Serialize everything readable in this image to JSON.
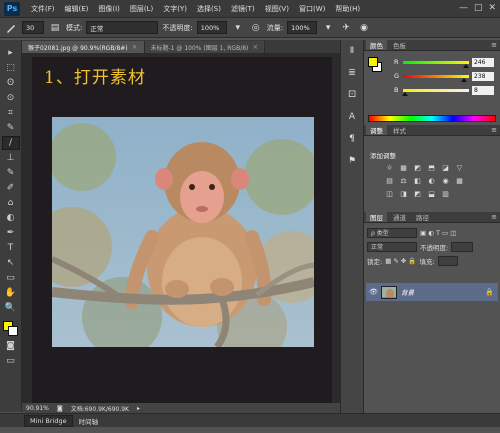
{
  "app": {
    "logo": "Ps"
  },
  "menu": [
    "文件(F)",
    "编辑(E)",
    "图像(I)",
    "图层(L)",
    "文字(Y)",
    "选择(S)",
    "滤镜(T)",
    "视图(V)",
    "窗口(W)",
    "帮助(H)"
  ],
  "window_controls": [
    "—",
    "□",
    "✕"
  ],
  "options": {
    "brush_size": "30",
    "mode_label": "模式:",
    "mode_value": "正常",
    "opacity_label": "不透明度:",
    "opacity_value": "100%",
    "flow_label": "流量:",
    "flow_value": "100%"
  },
  "doc_tabs": [
    {
      "label": "猴子02081.jpg @ 90.9%(RGB/8#)",
      "close": "×"
    },
    {
      "label": "未标题-1 @ 100% (图层 1, RGB/8)",
      "close": "×"
    }
  ],
  "canvas": {
    "step_title": "1、打开素材"
  },
  "status": {
    "zoom": "90.91%",
    "doc_info": "文档:690.9K/690.9K"
  },
  "bottom_tabs": [
    "Mini Bridge",
    "时间轴"
  ],
  "color_panel": {
    "tabs": [
      "颜色",
      "色板"
    ],
    "channels": [
      {
        "name": "R",
        "value": "246",
        "gradient": "linear-gradient(to right, #00f208, #fff208)",
        "knob": 0.96
      },
      {
        "name": "G",
        "value": "238",
        "gradient": "linear-gradient(to right, #f60008, #f6ff08)",
        "knob": 0.93
      },
      {
        "name": "B",
        "value": "8",
        "gradient": "linear-gradient(to right, #f6ee00, #f6eeff)",
        "knob": 0.03
      }
    ]
  },
  "adjust_panel": {
    "tabs": [
      "调整",
      "样式"
    ],
    "title": "添加调整",
    "icons": [
      "☼",
      "▦",
      "◩",
      "⬒",
      "◪",
      "▽",
      "",
      "▤",
      "⚖",
      "◧",
      "◐",
      "◉",
      "▦",
      "",
      "◫",
      "◨",
      "◩",
      "⬓",
      "▥",
      "",
      ""
    ]
  },
  "layers_panel": {
    "tabs": [
      "图层",
      "通道",
      "路径"
    ],
    "filter_label": "ρ 类型",
    "blend_mode": "正常",
    "opacity_label": "不透明度:",
    "lock_label": "锁定:",
    "fill_label": "填充:",
    "layer_name": "背景",
    "bottom_icons": [
      "ɕɔ",
      "fx",
      "◘",
      "◑",
      "▭",
      "▣",
      "🗑"
    ]
  },
  "tools": [
    "▸",
    "⬚",
    "ʘ",
    "⊙",
    "⌗",
    "✎",
    "∕",
    "⊥",
    "✎",
    "✐",
    "⌂",
    "◐",
    "✒",
    "T",
    "↖",
    "▭",
    "✋",
    "🔍"
  ],
  "mini_col_icons": [
    "Ⅱ",
    "≣",
    "⚀",
    "A",
    "¶",
    "⚑"
  ]
}
